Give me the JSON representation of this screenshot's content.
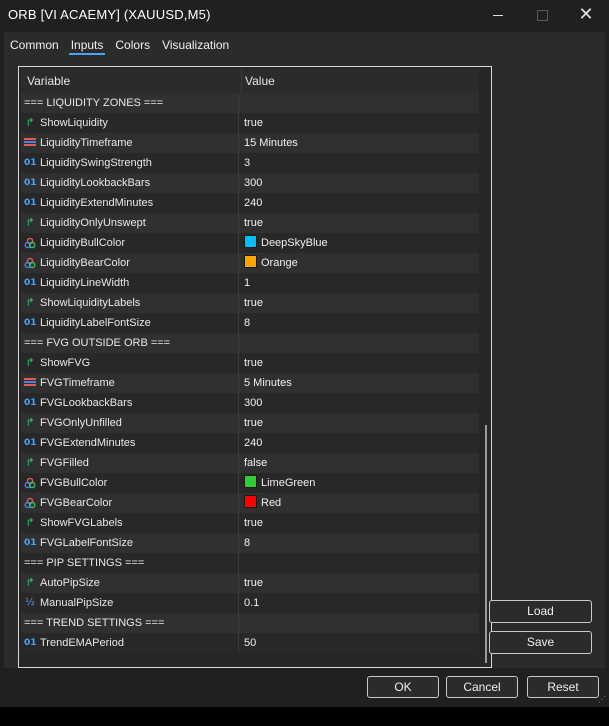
{
  "window": {
    "title": "ORB [VI ACAEMY] (XAUUSD,M5)",
    "minimize_label": "",
    "maximize_label": "",
    "close_label": "✕"
  },
  "tabs": [
    {
      "label": "Common"
    },
    {
      "label": "Inputs",
      "active": true
    },
    {
      "label": "Colors"
    },
    {
      "label": "Visualization"
    }
  ],
  "grid": {
    "header_variable": "Variable",
    "header_value": "Value",
    "rows": [
      {
        "type": "section",
        "name": "=== LIQUIDITY ZONES ===",
        "value": ""
      },
      {
        "type": "bool",
        "name": "ShowLiquidity",
        "value": "true"
      },
      {
        "type": "enum",
        "name": "LiquidityTimeframe",
        "value": "15 Minutes"
      },
      {
        "type": "int",
        "name": "LiquiditySwingStrength",
        "value": "3"
      },
      {
        "type": "int",
        "name": "LiquidityLookbackBars",
        "value": "300"
      },
      {
        "type": "int",
        "name": "LiquidityExtendMinutes",
        "value": "240"
      },
      {
        "type": "bool",
        "name": "LiquidityOnlyUnswept",
        "value": "true"
      },
      {
        "type": "color",
        "name": "LiquidityBullColor",
        "value": "DeepSkyBlue",
        "swatch": "#00bfff"
      },
      {
        "type": "color",
        "name": "LiquidityBearColor",
        "value": "Orange",
        "swatch": "#ffa500"
      },
      {
        "type": "int",
        "name": "LiquidityLineWidth",
        "value": "1"
      },
      {
        "type": "bool",
        "name": "ShowLiquidityLabels",
        "value": "true"
      },
      {
        "type": "int",
        "name": "LiquidityLabelFontSize",
        "value": "8"
      },
      {
        "type": "section",
        "name": "=== FVG OUTSIDE ORB ===",
        "value": ""
      },
      {
        "type": "bool",
        "name": "ShowFVG",
        "value": "true"
      },
      {
        "type": "enum",
        "name": "FVGTimeframe",
        "value": "5 Minutes"
      },
      {
        "type": "int",
        "name": "FVGLookbackBars",
        "value": "300"
      },
      {
        "type": "bool",
        "name": "FVGOnlyUnfilled",
        "value": "true"
      },
      {
        "type": "int",
        "name": "FVGExtendMinutes",
        "value": "240"
      },
      {
        "type": "bool",
        "name": "FVGFilled",
        "value": "false"
      },
      {
        "type": "color",
        "name": "FVGBullColor",
        "value": "LimeGreen",
        "swatch": "#32cd32"
      },
      {
        "type": "color",
        "name": "FVGBearColor",
        "value": "Red",
        "swatch": "#ff0000"
      },
      {
        "type": "bool",
        "name": "ShowFVGLabels",
        "value": "true"
      },
      {
        "type": "int",
        "name": "FVGLabelFontSize",
        "value": "8"
      },
      {
        "type": "section",
        "name": "=== PIP SETTINGS ===",
        "value": ""
      },
      {
        "type": "bool",
        "name": "AutoPipSize",
        "value": "true"
      },
      {
        "type": "double",
        "name": "ManualPipSize",
        "value": "0.1"
      },
      {
        "type": "section",
        "name": "=== TREND SETTINGS ===",
        "value": ""
      },
      {
        "type": "int",
        "name": "TrendEMAPeriod",
        "value": "50"
      }
    ]
  },
  "icons": {
    "bool": "bool-arrow-icon",
    "int": "integer-icon",
    "enum": "enum-icon",
    "color": "color-palette-icon",
    "double": "double-icon"
  },
  "buttons": {
    "load": "Load",
    "save": "Save",
    "ok": "OK",
    "cancel": "Cancel",
    "reset": "Reset"
  }
}
